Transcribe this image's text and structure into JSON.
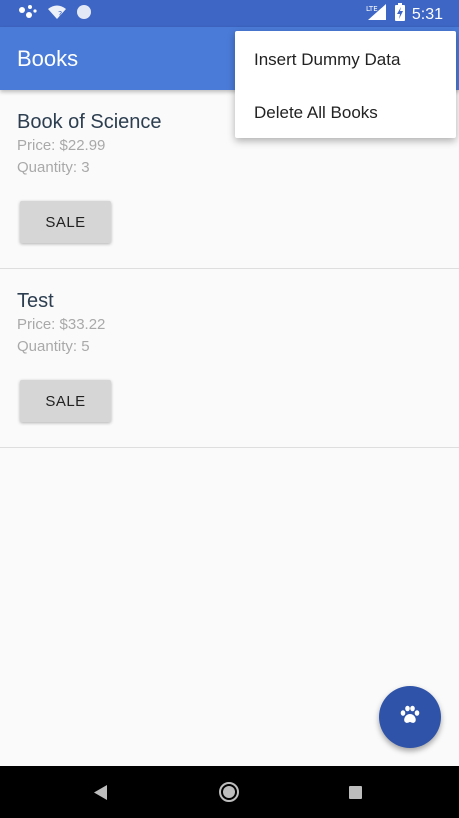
{
  "status_bar": {
    "time": "5:31",
    "network_label": "LTE",
    "icons": [
      "assistant-dots-icon",
      "wifi-question-icon",
      "sync-circle-icon",
      "signal-icon",
      "battery-charging-icon"
    ]
  },
  "app_bar": {
    "title": "Books"
  },
  "overflow_menu": {
    "items": [
      {
        "label": "Insert Dummy Data"
      },
      {
        "label": "Delete All Books"
      }
    ]
  },
  "books": [
    {
      "name": "Book of Science",
      "price": "Price: $22.99",
      "quantity": "Quantity: 3",
      "sale_label": "SALE"
    },
    {
      "name": "Test",
      "price": "Price: $33.22",
      "quantity": "Quantity: 5",
      "sale_label": "SALE"
    }
  ],
  "fab": {
    "icon": "paw-icon"
  },
  "nav_bar": {
    "icons": [
      "back-icon",
      "home-icon",
      "recents-icon"
    ]
  },
  "colors": {
    "status_bar": "#3e66c4",
    "app_bar": "#4a7bd8",
    "fab": "#2f53a8",
    "book_name": "#2c3e50",
    "secondary_text": "#a9a9a9",
    "sale_button": "#d6d6d6"
  }
}
